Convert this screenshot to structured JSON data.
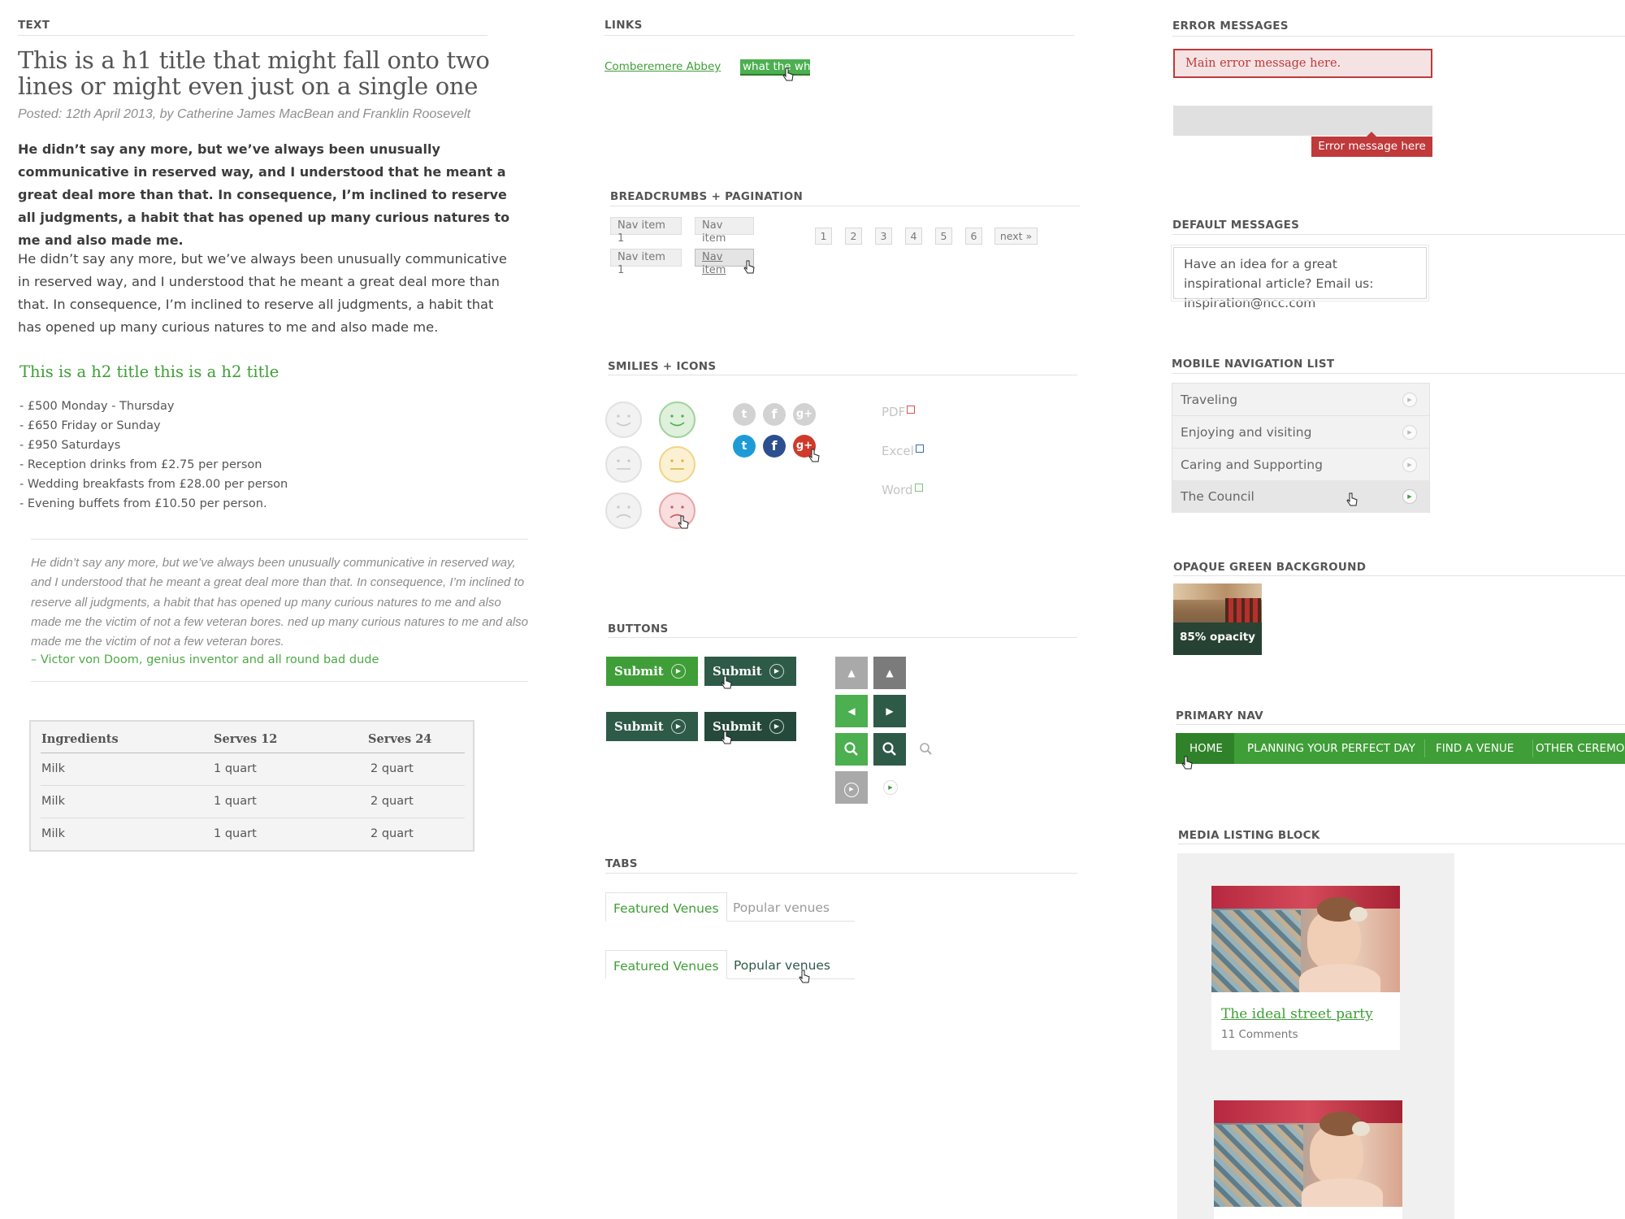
{
  "text_section": {
    "label": "TEXT",
    "h1": "This is a h1 title that might fall onto two lines or might even just on a single one",
    "posted": "Posted: 12th April 2013, by Catherine James MacBean and Franklin Roosevelt",
    "para_bold": "He didn’t say any more, but we’ve always been unusually communicative in reserved way, and I understood that he meant a great deal more than that. In consequence, I’m inclined to reserve all judgments, a habit that has opened up many curious natures to me and also made me.",
    "para": "He didn’t say any more, but we’ve always been unusually communicative in reserved way, and I understood that he meant a great deal more than that. In consequence, I’m inclined to reserve all judgments, a habit that has opened up many curious natures to me and also made me.",
    "h2": "This is a h2 title this is a h2 title",
    "list": [
      "- £500 Monday - Thursday",
      "- £650 Friday or Sunday",
      "- £950 Saturdays",
      "- Reception drinks from £2.75 per person",
      "- Wedding breakfasts from £28.00 per person",
      "- Evening buffets from £10.50 per person."
    ],
    "quote": "He didn’t say any more, but we’ve always been unusually communicative in reserved way, and I understood that he meant a great deal more than that. In consequence, I’m inclined to reserve all judgments, a habit that has opened up many curious natures to me and also made me the victim of not a few veteran bores. ned up many curious natures to me and also made me the victim of not a few veteran bores.",
    "quote_source": "– Victor von Doom, genius inventor and all round bad dude",
    "table": {
      "headers": [
        "Ingredients",
        "Serves 12",
        "Serves 24"
      ],
      "rows": [
        [
          "Milk",
          "1 quart",
          "2 quart"
        ],
        [
          "Milk",
          "1 quart",
          "2 quart"
        ],
        [
          "Milk",
          "1 quart",
          "2 quart"
        ]
      ]
    }
  },
  "links": {
    "label": "LINKS",
    "link1": "Comberemere Abbey",
    "link2": "what the wh"
  },
  "breadcrumbs": {
    "label": "BREADCRUMBS + PAGINATION",
    "row1": [
      "Nav item 1",
      "Nav item"
    ],
    "row2": [
      "Nav item 1",
      "Nav item"
    ],
    "pages": [
      "1",
      "2",
      "3",
      "4",
      "5",
      "6"
    ],
    "next": "next »"
  },
  "smilies": {
    "label": "SMILIES + ICONS",
    "social": [
      "t",
      "f",
      "g+"
    ],
    "docs": [
      "PDF",
      "Excel",
      "Word"
    ]
  },
  "buttons": {
    "label": "BUTTONS",
    "submit": "Submit"
  },
  "tabs": {
    "label": "TABS",
    "items": [
      "Featured Venues",
      "Popular venues"
    ]
  },
  "errors": {
    "label": "ERROR MESSAGES",
    "main": "Main error message here.",
    "tip": "Error message here"
  },
  "default_msg": {
    "label": "DEFAULT MESSAGES",
    "text": "Have an idea for a great inspirational article? Email us: inspiration@ncc.com"
  },
  "mobile_nav": {
    "label": "MOBILE NAVIGATION LIST",
    "items": [
      "Traveling",
      "Enjoying and visiting",
      "Caring and Supporting",
      "The Council"
    ]
  },
  "opaque": {
    "label": "OPAQUE GREEN BACKGROUND",
    "caption": "85% opacity"
  },
  "primary_nav": {
    "label": "PRIMARY NAV",
    "items": [
      "HOME",
      "PLANNING YOUR PERFECT DAY",
      "FIND A VENUE",
      "OTHER CEREMON"
    ]
  },
  "media": {
    "label": "MEDIA LISTING BLOCK",
    "title": "The ideal street party",
    "comments": "11 Comments"
  },
  "colors": {
    "green": "#3f9e37",
    "dark_green": "#2e5a48",
    "error_red": "#c0393b"
  }
}
